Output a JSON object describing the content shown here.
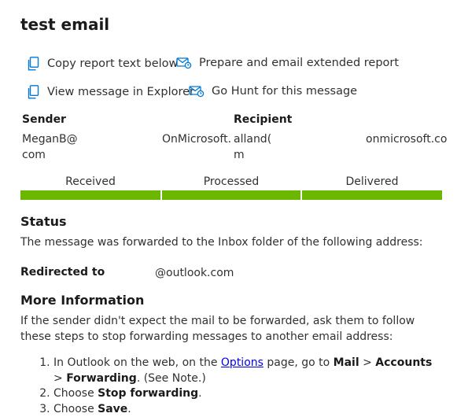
{
  "title": "test email",
  "actions": {
    "copy_report": "Copy report text below",
    "email_report": "Prepare and email extended report",
    "view_explorer": "View message in Explorer",
    "go_hunt": "Go Hunt for this message"
  },
  "sender": {
    "label": "Sender",
    "value_part1": "MeganB@",
    "value_part2": "OnMicrosoft.",
    "value_part3": "com"
  },
  "recipient": {
    "label": "Recipient",
    "value_part1": "alland(",
    "value_part2": "onmicrosoft.co",
    "value_part3": "m"
  },
  "stages": [
    {
      "label": "Received"
    },
    {
      "label": "Processed"
    },
    {
      "label": "Delivered"
    }
  ],
  "status": {
    "heading": "Status",
    "text": "The message was forwarded to the Inbox folder of the following address:"
  },
  "redirected": {
    "label": "Redirected to",
    "value": "@outlook.com"
  },
  "more_info": {
    "heading": "More Information",
    "text": "If the sender didn't expect the mail to be forwarded, ask them to follow these steps to stop forwarding messages to another email address:",
    "step1_prefix": "In Outlook on the web, on the ",
    "step1_link": "Options",
    "step1_mid": " page, go to ",
    "step1_mail": "Mail",
    "step1_sep1": " > ",
    "step1_accounts": "Accounts",
    "step1_sep2": " > ",
    "step1_forwarding": "Forwarding",
    "step1_note": ". (See Note.)",
    "step2_prefix": "Choose ",
    "step2_bold": "Stop forwarding",
    "step2_suffix": ".",
    "step3_prefix": "Choose ",
    "step3_bold": "Save",
    "step3_suffix": "."
  },
  "colors": {
    "progress": "#6bb700",
    "link": "#0000ee",
    "icon": "#0078d4"
  }
}
